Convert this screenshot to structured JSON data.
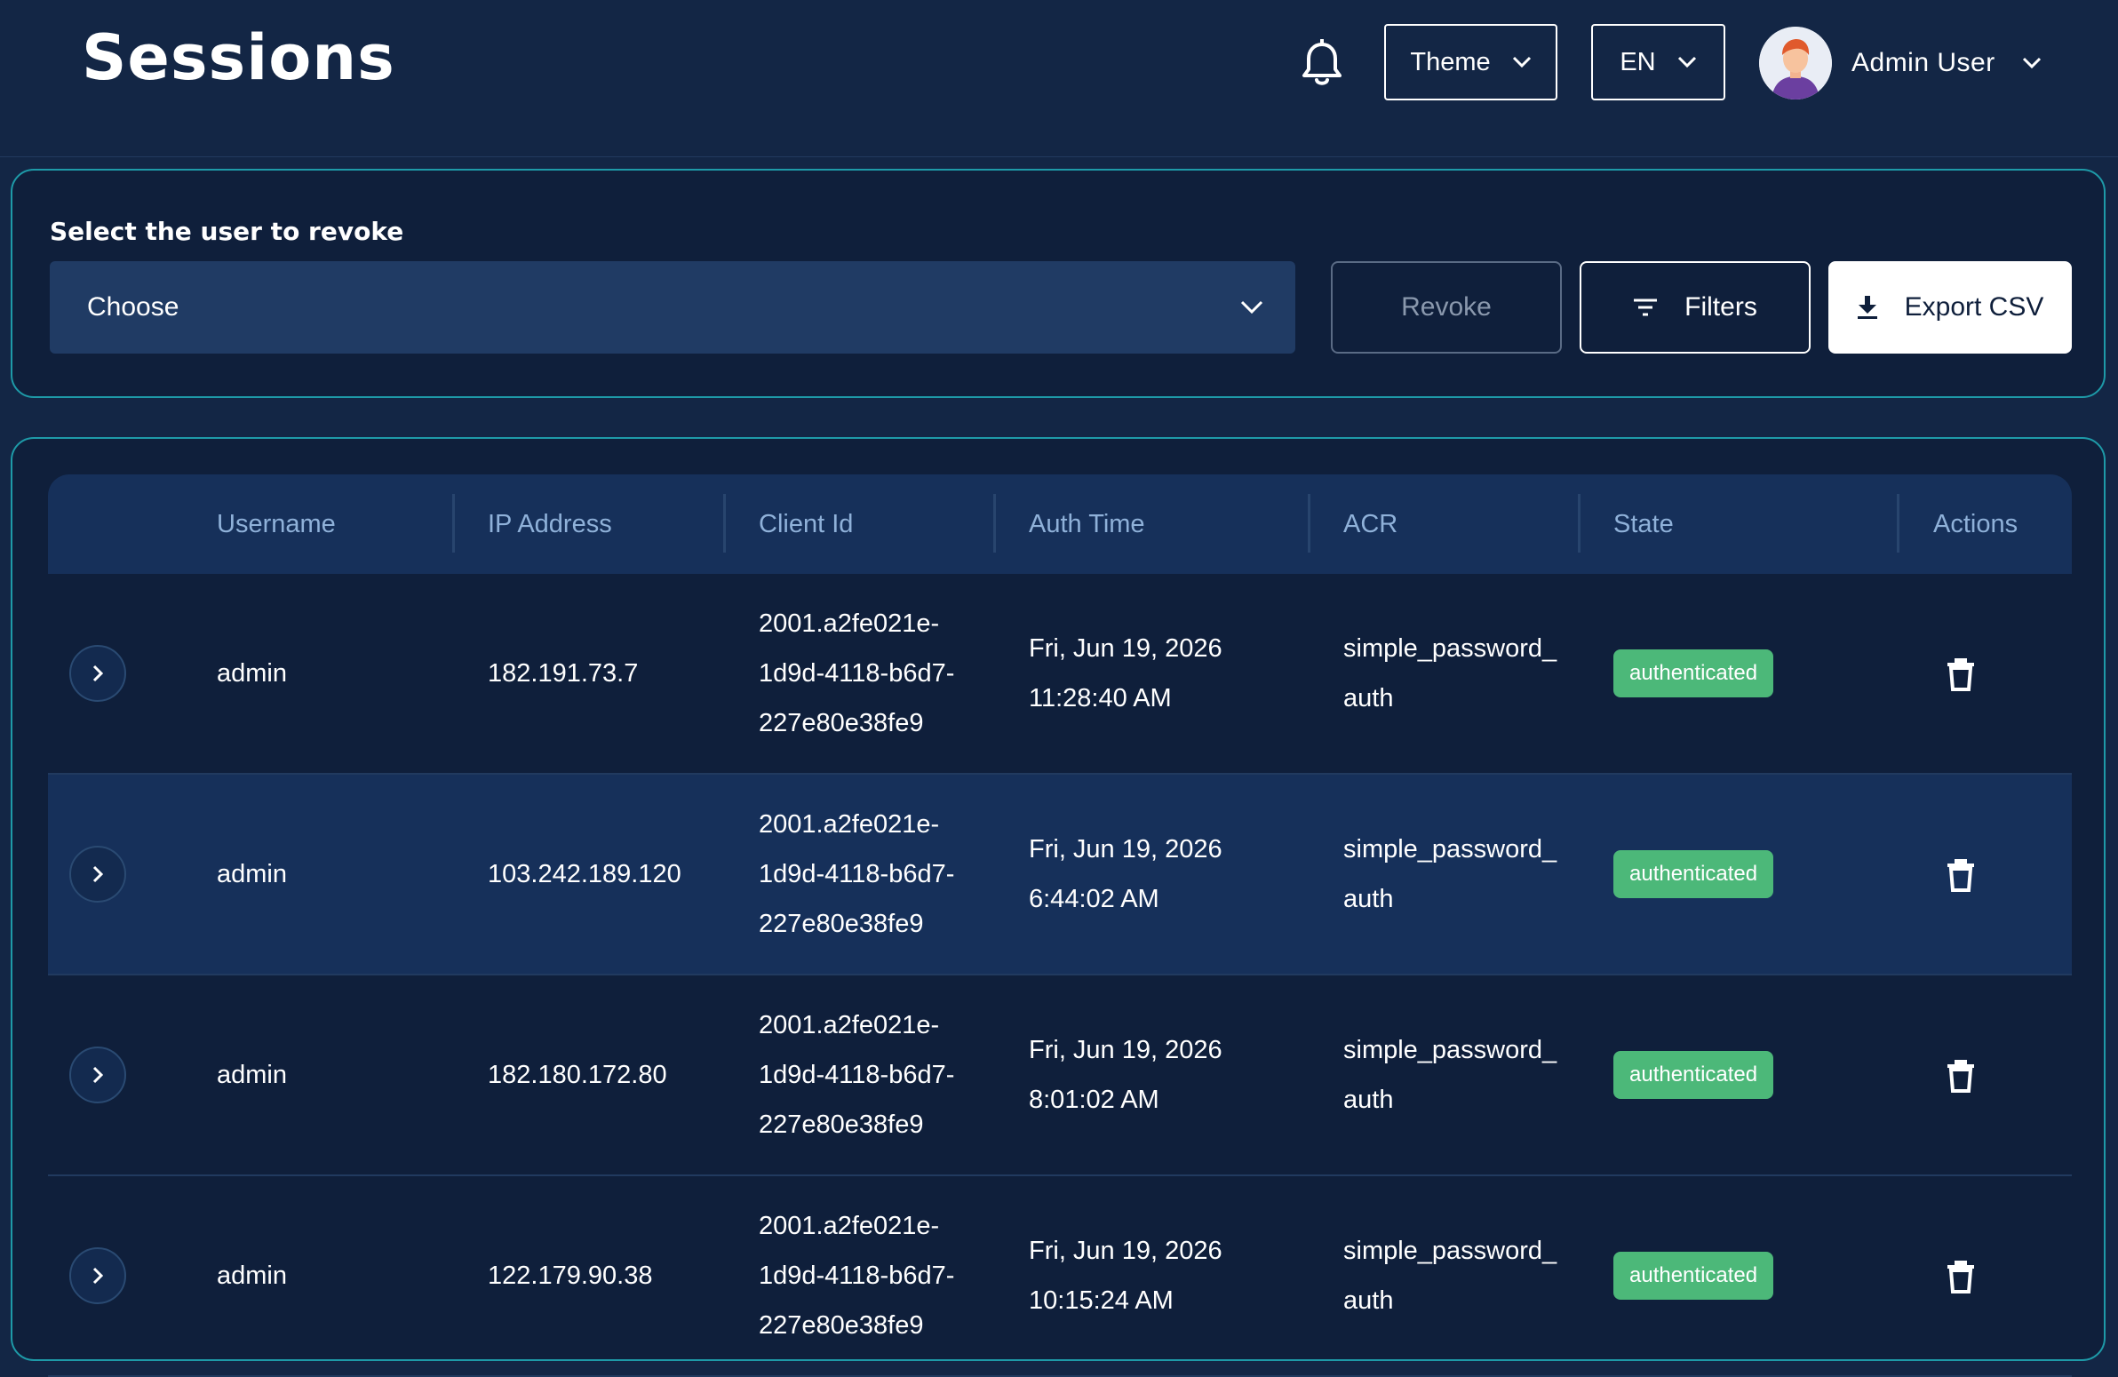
{
  "header": {
    "title": "Sessions",
    "theme_label": "Theme",
    "language_label": "EN",
    "user_name": "Admin User"
  },
  "revoke": {
    "label": "Select the user to revoke",
    "select_value": "Choose",
    "revoke_label": "Revoke",
    "filters_label": "Filters",
    "export_label": "Export CSV"
  },
  "table": {
    "columns": [
      "Username",
      "IP Address",
      "Client Id",
      "Auth Time",
      "ACR",
      "State",
      "Actions"
    ],
    "rows": [
      {
        "username": "admin",
        "ip": "182.191.73.7",
        "client_id": [
          "2001.a2fe021e-",
          "1d9d-4118-b6d7-",
          "227e80e38fe9"
        ],
        "auth_time": [
          "Fri, Jun 19, 2026",
          "11:28:40 AM"
        ],
        "acr": [
          "simple_password_",
          "auth"
        ],
        "state": "authenticated"
      },
      {
        "username": "admin",
        "ip": "103.242.189.120",
        "client_id": [
          "2001.a2fe021e-",
          "1d9d-4118-b6d7-",
          "227e80e38fe9"
        ],
        "auth_time": [
          "Fri, Jun 19, 2026",
          "6:44:02 AM"
        ],
        "acr": [
          "simple_password_",
          "auth"
        ],
        "state": "authenticated"
      },
      {
        "username": "admin",
        "ip": "182.180.172.80",
        "client_id": [
          "2001.a2fe021e-",
          "1d9d-4118-b6d7-",
          "227e80e38fe9"
        ],
        "auth_time": [
          "Fri, Jun 19, 2026",
          "8:01:02 AM"
        ],
        "acr": [
          "simple_password_",
          "auth"
        ],
        "state": "authenticated"
      },
      {
        "username": "admin",
        "ip": "122.179.90.38",
        "client_id": [
          "2001.a2fe021e-",
          "1d9d-4118-b6d7-",
          "227e80e38fe9"
        ],
        "auth_time": [
          "Fri, Jun 19, 2026",
          "10:15:24 AM"
        ],
        "acr": [
          "simple_password_",
          "auth"
        ],
        "state": "authenticated"
      }
    ]
  },
  "colors": {
    "background": "#132645",
    "panel_border": "#1e9aa8",
    "badge": "#4cb879",
    "header_text": "#8fb1d9"
  },
  "icons": [
    "bell-icon",
    "chevron-down-icon",
    "filter-icon",
    "download-icon",
    "chevron-right-icon",
    "trash-icon"
  ]
}
